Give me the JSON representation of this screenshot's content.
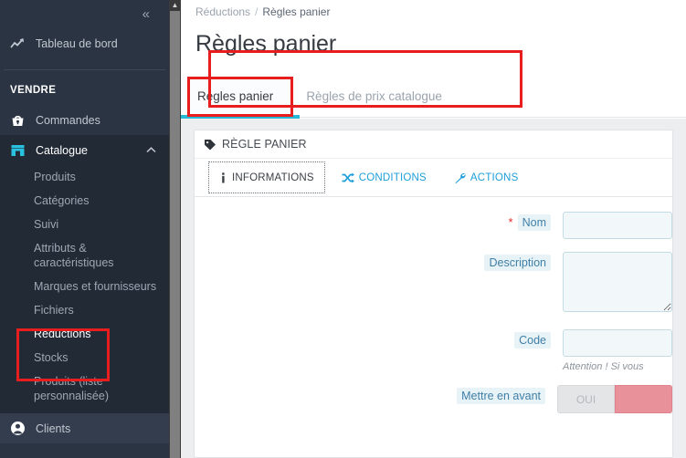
{
  "sidebar": {
    "collapse_icon": "double-chevron-left-icon",
    "dashboard": {
      "label": "Tableau de bord",
      "icon": "trend-up-icon"
    },
    "section_label": "VENDRE",
    "orders": {
      "label": "Commandes",
      "icon": "basket-icon"
    },
    "catalog": {
      "label": "Catalogue",
      "icon": "store-icon",
      "expanded_icon": "chevron-up-icon"
    },
    "catalog_children": [
      {
        "label": "Produits",
        "selected": false
      },
      {
        "label": "Catégories",
        "selected": false
      },
      {
        "label": "Suivi",
        "selected": false
      },
      {
        "label": "Attributs & caractéristiques",
        "selected": false
      },
      {
        "label": "Marques et fournisseurs",
        "selected": false
      },
      {
        "label": "Fichiers",
        "selected": false
      },
      {
        "label": "Réductions",
        "selected": true
      },
      {
        "label": "Stocks",
        "selected": false
      },
      {
        "label": "Produits (liste personnalisée)",
        "selected": false
      }
    ],
    "customers": {
      "label": "Clients",
      "icon": "user-icon"
    }
  },
  "breadcrumb": {
    "parent": "Réductions",
    "separator": "/",
    "current": "Règles panier"
  },
  "page": {
    "title": "Règles panier"
  },
  "tabs": [
    {
      "label": "Règles panier",
      "active": true
    },
    {
      "label": "Règles de prix catalogue",
      "active": false
    }
  ],
  "panel": {
    "icon": "tag-icon",
    "title": "RÈGLE PANIER",
    "inner_tabs": [
      {
        "label": "INFORMATIONS",
        "icon": "info-icon",
        "active": true
      },
      {
        "label": "CONDITIONS",
        "icon": "shuffle-icon",
        "active": false
      },
      {
        "label": "ACTIONS",
        "icon": "wrench-icon",
        "active": false
      }
    ],
    "fields": {
      "name": {
        "label": "Nom",
        "required_mark": "*",
        "value": "",
        "placeholder": ""
      },
      "description": {
        "label": "Description",
        "value": "",
        "placeholder": ""
      },
      "code": {
        "label": "Code",
        "value": "",
        "placeholder": "",
        "help": "Attention ! Si vous"
      },
      "highlight": {
        "label": "Mettre en avant",
        "option_yes": "OUI",
        "selected": ""
      }
    }
  },
  "colors": {
    "sidebar_bg": "#2b3443",
    "sidebar_active_bg": "#222a36",
    "accent_cyan": "#25b9d7",
    "link_blue": "#1e9ed9",
    "annotation_red": "#e81d1d",
    "label_bg": "#e8f3f8",
    "label_text": "#3f7fa6",
    "input_bg": "#f2f7fa",
    "page_bg": "#eceef0"
  }
}
